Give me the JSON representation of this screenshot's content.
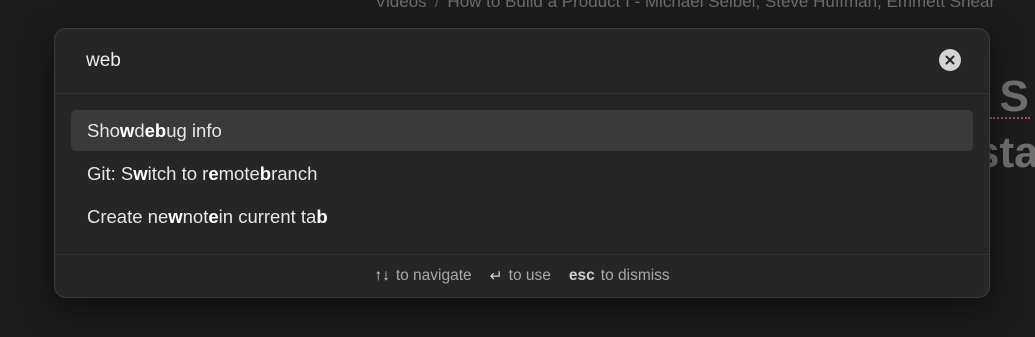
{
  "background": {
    "breadcrumb_parent": "Videos",
    "breadcrumb_separator": "/",
    "breadcrumb_current": "How to Build a Product I - Michael Seibel, Steve Huffman, Emmett Shear",
    "heading_line1": "l S",
    "heading_line2": "sta"
  },
  "search": {
    "value": "web",
    "clear_icon": "close-circle-icon"
  },
  "results": [
    {
      "segments": [
        {
          "text": "Sho",
          "bold": false
        },
        {
          "text": "w",
          "bold": true
        },
        {
          "text": " d",
          "bold": false
        },
        {
          "text": "eb",
          "bold": true
        },
        {
          "text": "ug info",
          "bold": false
        }
      ],
      "selected": true
    },
    {
      "segments": [
        {
          "text": "Git: S",
          "bold": false
        },
        {
          "text": "w",
          "bold": true
        },
        {
          "text": "itch to r",
          "bold": false
        },
        {
          "text": "e",
          "bold": true
        },
        {
          "text": "mote ",
          "bold": false
        },
        {
          "text": "b",
          "bold": true
        },
        {
          "text": "ranch",
          "bold": false
        }
      ],
      "selected": false
    },
    {
      "segments": [
        {
          "text": "Create ne",
          "bold": false
        },
        {
          "text": "w",
          "bold": true
        },
        {
          "text": " not",
          "bold": false
        },
        {
          "text": "e",
          "bold": true
        },
        {
          "text": " in current ta",
          "bold": false
        },
        {
          "text": "b",
          "bold": true
        }
      ],
      "selected": false
    }
  ],
  "footer": {
    "navigate_key": "↑↓",
    "navigate_label": "to navigate",
    "use_key": "↵",
    "use_label": "to use",
    "dismiss_key": "esc",
    "dismiss_label": "to dismiss"
  },
  "colors": {
    "backdrop": "#1c1c1c",
    "panel": "#262626",
    "selected_row": "#3a3a3a",
    "text": "#e6e6e6",
    "muted": "#a8a8a8"
  }
}
